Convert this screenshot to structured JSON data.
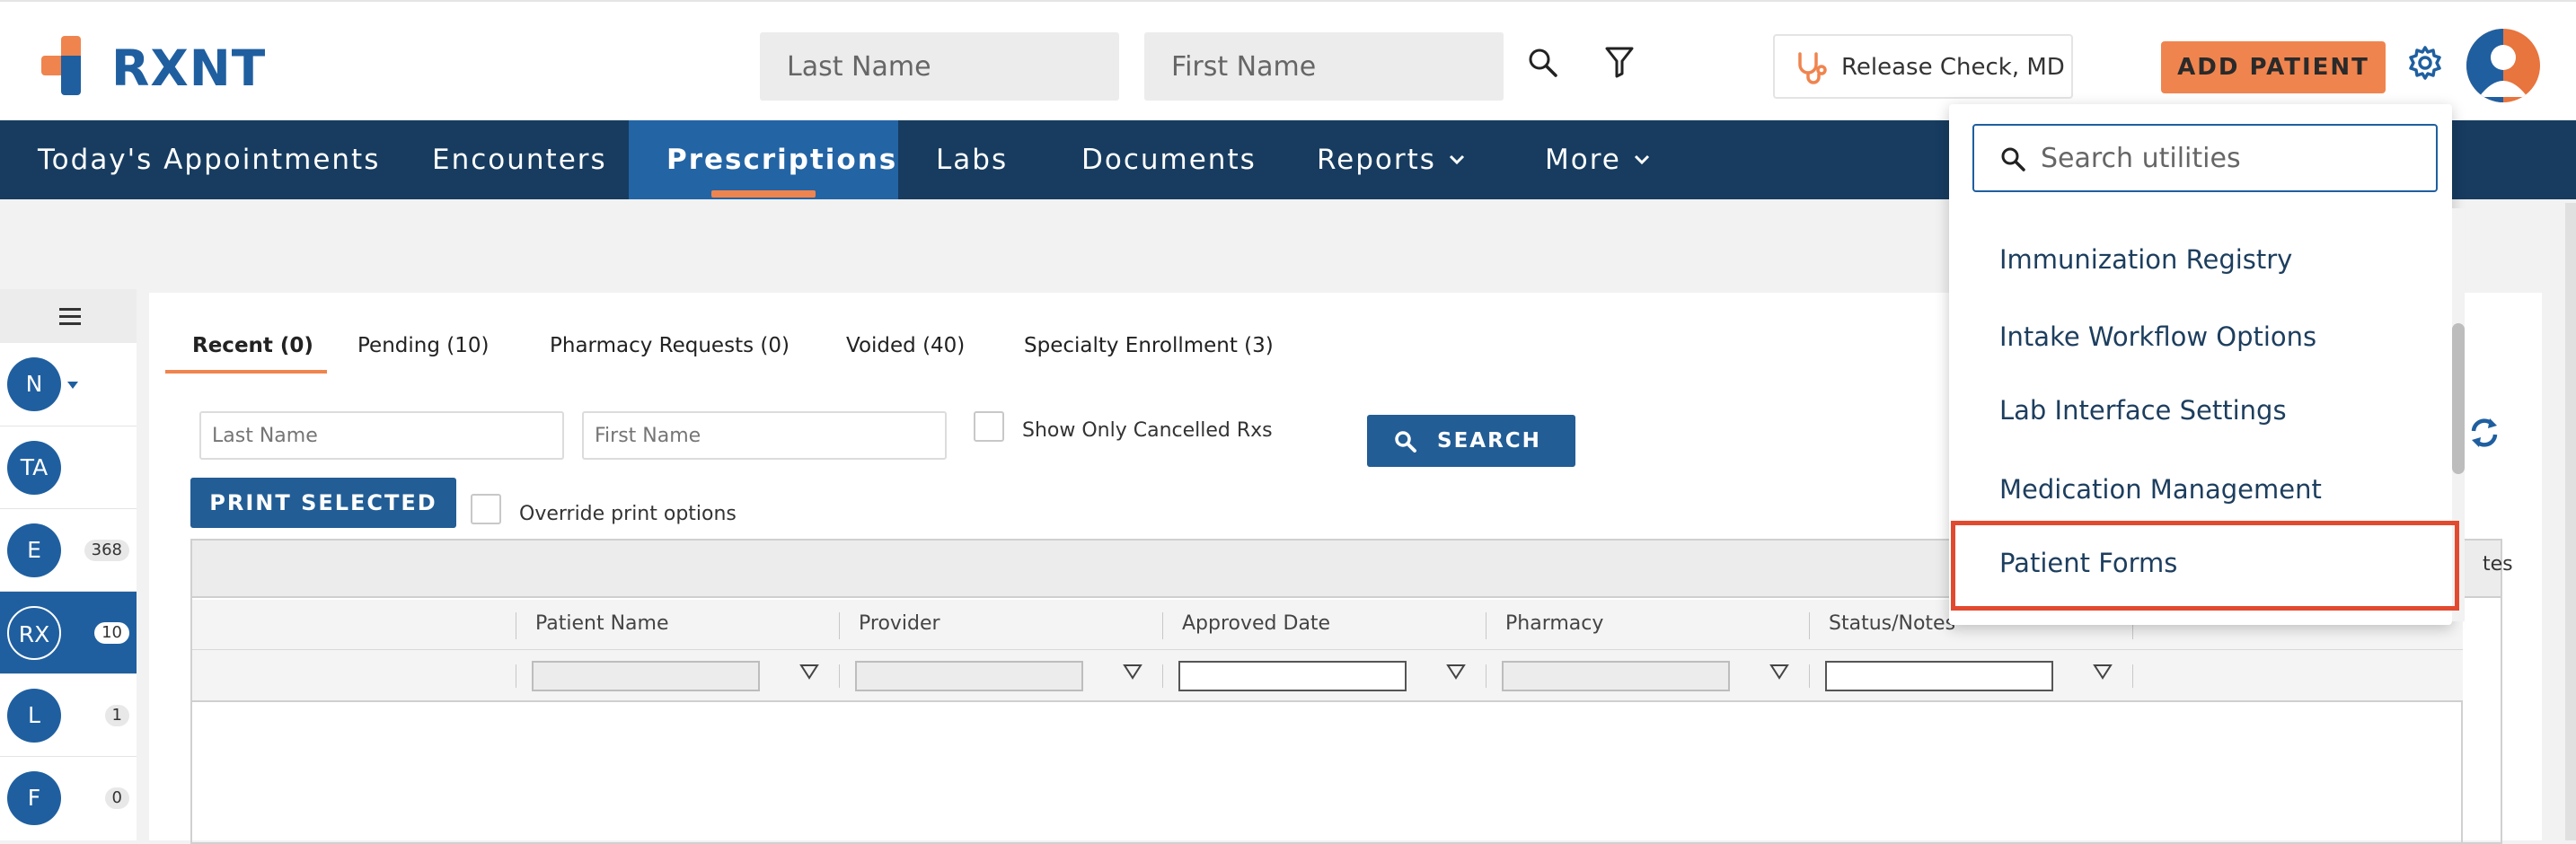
{
  "header": {
    "logo_text": "RXNT",
    "last_name_placeholder": "Last Name",
    "first_name_placeholder": "First Name",
    "provider": "Release Check, MD",
    "add_patient": "ADD PATIENT",
    "brand_color": "#1f5fa0",
    "accent_color": "#f0844e"
  },
  "nav": {
    "items": [
      "Today's Appointments",
      "Encounters",
      "Prescriptions",
      "Labs",
      "Documents",
      "Reports",
      "More"
    ],
    "active": "Prescriptions"
  },
  "rail": {
    "items": [
      {
        "label": "N",
        "badge": ""
      },
      {
        "label": "TA",
        "badge": ""
      },
      {
        "label": "E",
        "badge": "368"
      },
      {
        "label": "RX",
        "badge": "10"
      },
      {
        "label": "L",
        "badge": "1"
      },
      {
        "label": "F",
        "badge": "0"
      }
    ]
  },
  "tabs": [
    "Recent (0)",
    "Pending (10)",
    "Pharmacy Requests (0)",
    "Voided (40)",
    "Specialty Enrollment (3)"
  ],
  "filters": {
    "last_name_placeholder": "Last Name",
    "first_name_placeholder": "First Name",
    "show_cancelled": "Show Only Cancelled Rxs",
    "search": "SEARCH",
    "print_selected": "PRINT SELECTED",
    "override": "Override print options"
  },
  "grid": {
    "top_right_fragment": "tes",
    "columns": [
      "Patient Name",
      "Provider",
      "Approved Date",
      "Pharmacy",
      "Status/Notes"
    ]
  },
  "utilities": {
    "search_placeholder": "Search utilities",
    "items": [
      "Immunization Registry",
      "Intake Workflow Options",
      "Lab Interface Settings",
      "Medication Management",
      "Patient Forms"
    ],
    "highlighted": "Patient Forms",
    "highlight_color": "#e24a2f"
  }
}
